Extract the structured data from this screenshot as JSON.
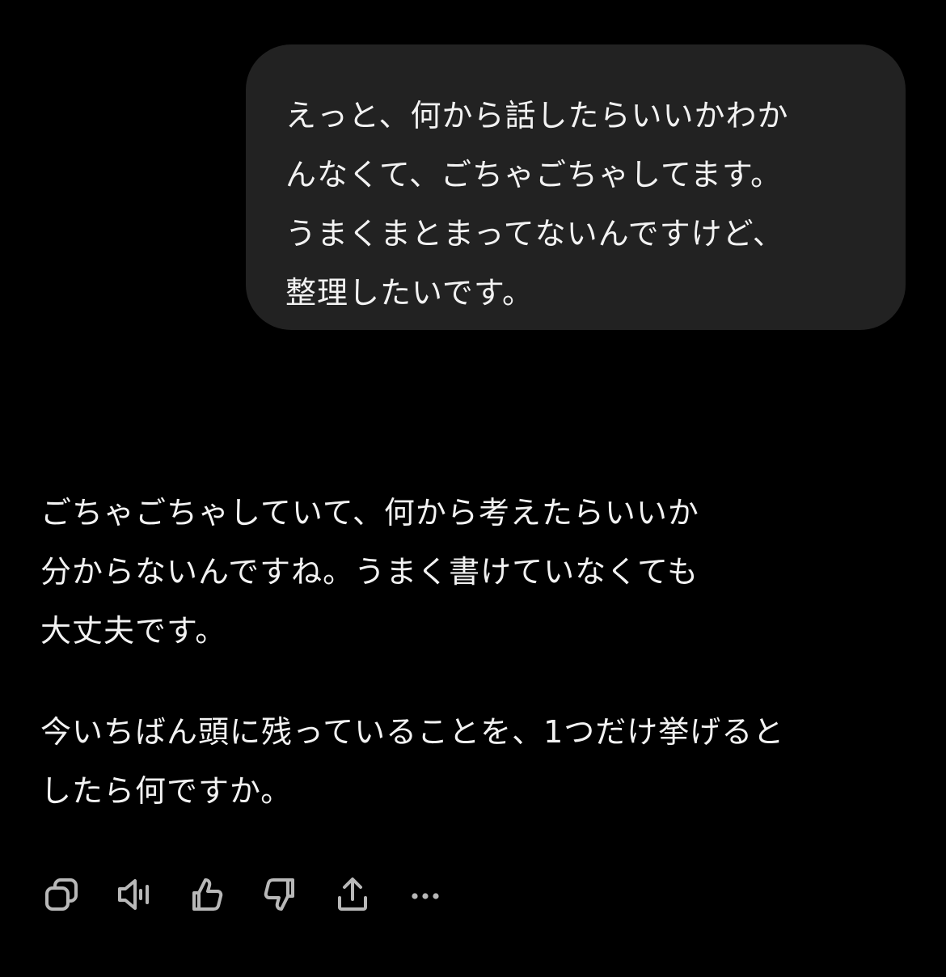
{
  "user_message": {
    "lines": [
      "えっと、何から話したらいいかわか",
      "んなくて、ごちゃごちゃしてます。",
      "うまくまとまってないんですけど、",
      "整理したいです。"
    ]
  },
  "assistant_message": {
    "paragraph1": [
      "ごちゃごちゃしていて、何から考えたらいいか",
      "分からないんですね。うまく書けていなくても",
      "大丈夫です。"
    ],
    "paragraph2": [
      "今いちばん頭に残っていることを、1つだけ挙げると",
      "したら何ですか。"
    ]
  },
  "actions": [
    "copy-icon",
    "speaker-icon",
    "thumbs-up-icon",
    "thumbs-down-icon",
    "share-icon",
    "more-icon"
  ],
  "colors": {
    "background": "#000000",
    "bubble": "#222222",
    "text": "#f2f2f2",
    "icon": "#b8b8b8"
  }
}
